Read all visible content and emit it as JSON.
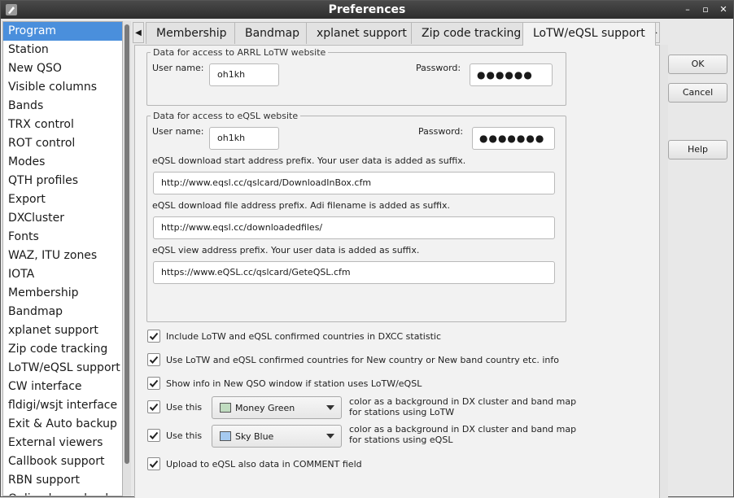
{
  "window": {
    "title": "Preferences",
    "controls": [
      "–",
      "▫",
      "✕"
    ]
  },
  "sidebar": {
    "items": [
      {
        "label": "Program",
        "selected": true
      },
      {
        "label": "Station"
      },
      {
        "label": "New QSO"
      },
      {
        "label": "Visible columns"
      },
      {
        "label": "Bands"
      },
      {
        "label": "TRX control"
      },
      {
        "label": "ROT control"
      },
      {
        "label": "Modes"
      },
      {
        "label": "QTH profiles"
      },
      {
        "label": "Export"
      },
      {
        "label": "DXCluster"
      },
      {
        "label": "Fonts"
      },
      {
        "label": "WAZ, ITU zones"
      },
      {
        "label": "IOTA"
      },
      {
        "label": "Membership"
      },
      {
        "label": "Bandmap"
      },
      {
        "label": "xplanet support"
      },
      {
        "label": "Zip code tracking"
      },
      {
        "label": "LoTW/eQSL support"
      },
      {
        "label": "CW interface"
      },
      {
        "label": "fldigi/wsjt interface"
      },
      {
        "label": "Exit & Auto backup"
      },
      {
        "label": "External viewers"
      },
      {
        "label": "Callbook support"
      },
      {
        "label": "RBN support"
      },
      {
        "label": "Online log upload"
      }
    ]
  },
  "tabs": {
    "left_arrow": "◀",
    "right_arrow": "▶",
    "items": [
      {
        "label": "Membership"
      },
      {
        "label": "Bandmap"
      },
      {
        "label": "xplanet support"
      },
      {
        "label": "Zip code tracking"
      },
      {
        "label": "LoTW/eQSL support",
        "active": true
      }
    ]
  },
  "lotw": {
    "legend": "Data for access to ARRL LoTW website",
    "user_label": "User name:",
    "user_value": "oh1kh",
    "password_label": "Password:",
    "password_value": "●●●●●●"
  },
  "eqsl": {
    "legend": "Data for access to eQSL website",
    "user_label": "User name:",
    "user_value": "oh1kh",
    "password_label": "Password:",
    "password_value": "●●●●●●●",
    "download_start_label": "eQSL download start address prefix. Your user data is added  as suffix.",
    "download_start_value": "http://www.eqsl.cc/qslcard/DownloadInBox.cfm",
    "download_file_label": "eQSL download file address prefix. Adi filename is added as suffix.",
    "download_file_value": "http://www.eqsl.cc/downloadedfiles/",
    "view_label": "eQSL view address prefix. Your user data is added  as suffix.",
    "view_value": "https://www.eQSL.cc/qslcard/GeteQSL.cfm"
  },
  "options": {
    "include_dxcc": "Include LoTW and eQSL confirmed countries in DXCC statistic",
    "use_new_country": "Use LoTW and eQSL confirmed countries for New country or New band country etc. info",
    "show_info": "Show info in New QSO window if station uses LoTW/eQSL",
    "use_this_1": "Use this",
    "color_lotw": "Money Green",
    "color_lotw_hex": "#c0dcc0",
    "note_lotw_1": "color as a background in DX cluster and band map",
    "note_lotw_2": "for stations using LoTW",
    "use_this_2": "Use this",
    "color_eqsl": "Sky Blue",
    "color_eqsl_hex": "#a6caf0",
    "note_eqsl_1": "color as a background in DX cluster and band map",
    "note_eqsl_2": "for stations using eQSL",
    "upload_comment": "Upload to eQSL also data in COMMENT field"
  },
  "buttons": {
    "ok": "OK",
    "cancel": "Cancel",
    "help": "Help"
  }
}
